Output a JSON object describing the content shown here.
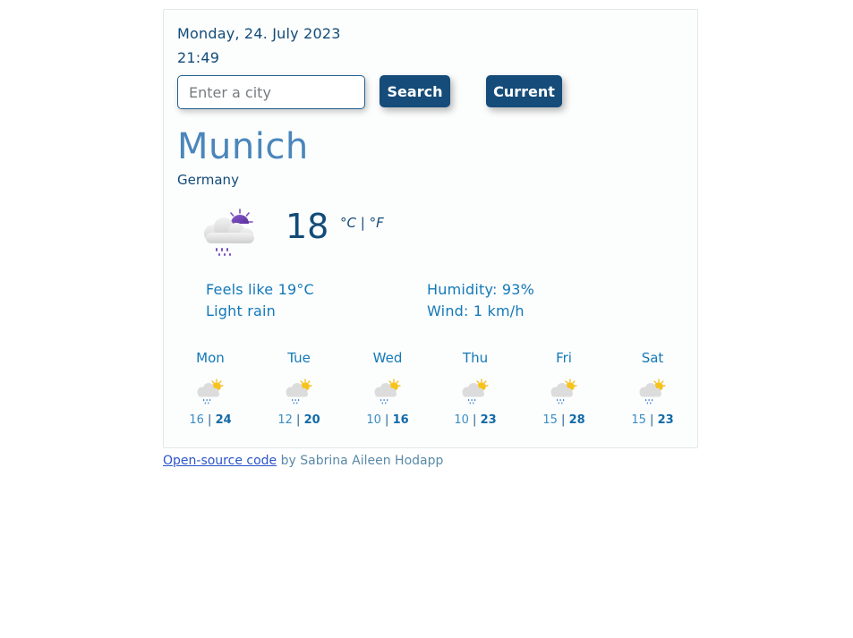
{
  "header": {
    "date": "Monday, 24. July 2023",
    "time": "21:49"
  },
  "search": {
    "placeholder": "Enter a city",
    "value": "",
    "search_label": "Search",
    "current_label": "Current"
  },
  "location": {
    "city": "Munich",
    "country": "Germany"
  },
  "current": {
    "icon": "partly-cloudy-night-rain-icon",
    "temperature": "18",
    "unit_celsius": "°C",
    "unit_separator": "|",
    "unit_fahrenheit": "°F",
    "feels_like": "Feels like 19°C",
    "description": "Light rain",
    "humidity": "Humidity: 93%",
    "wind": "Wind: 1 km/h"
  },
  "forecast": [
    {
      "day": "Mon",
      "icon": "sun-cloud-rain-icon",
      "min": "16",
      "max": "24"
    },
    {
      "day": "Tue",
      "icon": "sun-cloud-rain-icon",
      "min": "12",
      "max": "20"
    },
    {
      "day": "Wed",
      "icon": "sun-cloud-rain-icon",
      "min": "10",
      "max": "16"
    },
    {
      "day": "Thu",
      "icon": "sun-cloud-rain-icon",
      "min": "10",
      "max": "23"
    },
    {
      "day": "Fri",
      "icon": "sun-cloud-rain-icon",
      "min": "15",
      "max": "28"
    },
    {
      "day": "Sat",
      "icon": "sun-cloud-rain-icon",
      "min": "15",
      "max": "23"
    }
  ],
  "forecast_separator": "|",
  "footer": {
    "link_text": "Open-source code",
    "suffix": " by Sabrina Aileen Hodapp"
  },
  "colors": {
    "primary": "#154c79",
    "city": "#4a86bb",
    "detail": "#1379b8",
    "link": "#2b55c8"
  }
}
